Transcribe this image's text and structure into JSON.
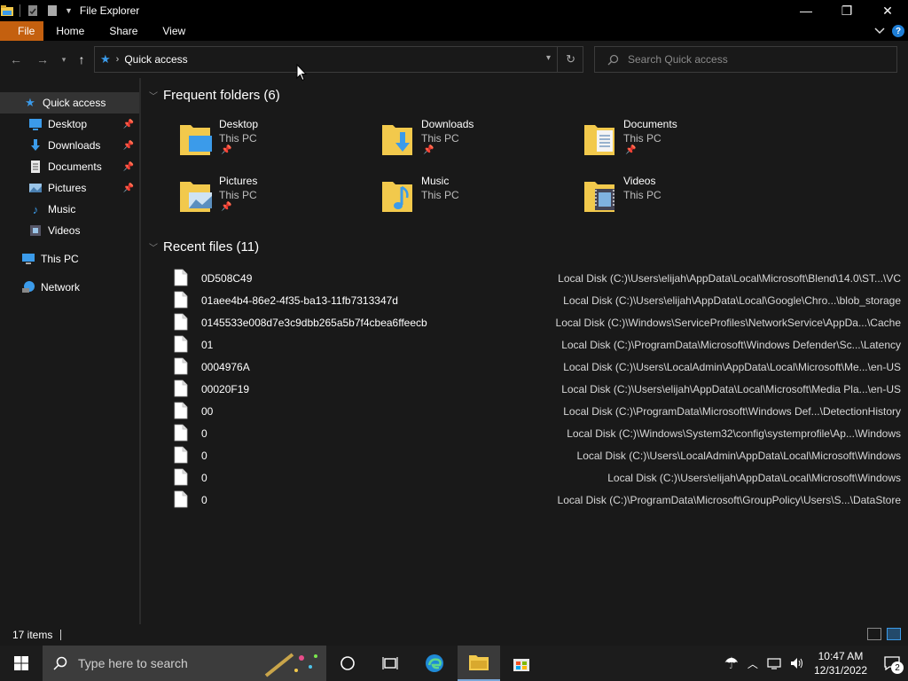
{
  "window": {
    "title": "File Explorer",
    "controls": {
      "minimize": "—",
      "restore": "❐",
      "close": "✕"
    }
  },
  "ribbon": {
    "tabs": [
      "File",
      "Home",
      "Share",
      "View"
    ],
    "help": "?"
  },
  "address": {
    "path": "Quick access",
    "star": "★",
    "chevron": "›",
    "refresh": "↻"
  },
  "search": {
    "placeholder": "Search Quick access"
  },
  "sidebar": {
    "items": [
      {
        "label": "Quick access",
        "icon": "star-icon",
        "color": "#3b9bea"
      },
      {
        "label": "Desktop",
        "icon": "desktop-icon",
        "pinned": true
      },
      {
        "label": "Downloads",
        "icon": "download-icon",
        "pinned": true
      },
      {
        "label": "Documents",
        "icon": "document-icon",
        "pinned": true
      },
      {
        "label": "Pictures",
        "icon": "picture-icon",
        "pinned": true
      },
      {
        "label": "Music",
        "icon": "music-icon"
      },
      {
        "label": "Videos",
        "icon": "video-icon"
      },
      {
        "label": "This PC",
        "icon": "computer-icon"
      },
      {
        "label": "Network",
        "icon": "network-icon"
      }
    ]
  },
  "frequent": {
    "header": "Frequent folders (6)",
    "folders": [
      {
        "name": "Desktop",
        "location": "This PC"
      },
      {
        "name": "Downloads",
        "location": "This PC"
      },
      {
        "name": "Documents",
        "location": "This PC"
      },
      {
        "name": "Pictures",
        "location": "This PC"
      },
      {
        "name": "Music",
        "location": "This PC"
      },
      {
        "name": "Videos",
        "location": "This PC"
      }
    ]
  },
  "recent": {
    "header": "Recent files (11)",
    "files": [
      {
        "name": "0D508C49",
        "path": "Local Disk (C:)\\Users\\elijah\\AppData\\Local\\Microsoft\\Blend\\14.0\\ST...\\VC"
      },
      {
        "name": "01aee4b4-86e2-4f35-ba13-11fb7313347d",
        "path": "Local Disk (C:)\\Users\\elijah\\AppData\\Local\\Google\\Chro...\\blob_storage"
      },
      {
        "name": "0145533e008d7e3c9dbb265a5b7f4cbea6ffeecb",
        "path": "Local Disk (C:)\\Windows\\ServiceProfiles\\NetworkService\\AppDa...\\Cache"
      },
      {
        "name": "01",
        "path": "Local Disk (C:)\\ProgramData\\Microsoft\\Windows Defender\\Sc...\\Latency"
      },
      {
        "name": "0004976A",
        "path": "Local Disk (C:)\\Users\\LocalAdmin\\AppData\\Local\\Microsoft\\Me...\\en-US"
      },
      {
        "name": "00020F19",
        "path": "Local Disk (C:)\\Users\\elijah\\AppData\\Local\\Microsoft\\Media Pla...\\en-US"
      },
      {
        "name": "00",
        "path": "Local Disk (C:)\\ProgramData\\Microsoft\\Windows Def...\\DetectionHistory"
      },
      {
        "name": "0",
        "path": "Local Disk (C:)\\Windows\\System32\\config\\systemprofile\\Ap...\\Windows"
      },
      {
        "name": "0",
        "path": "Local Disk (C:)\\Users\\LocalAdmin\\AppData\\Local\\Microsoft\\Windows"
      },
      {
        "name": "0",
        "path": "Local Disk (C:)\\Users\\elijah\\AppData\\Local\\Microsoft\\Windows"
      },
      {
        "name": "0",
        "path": "Local Disk (C:)\\ProgramData\\Microsoft\\GroupPolicy\\Users\\S...\\DataStore"
      }
    ]
  },
  "status": {
    "count": "17 items"
  },
  "taskbar": {
    "search_placeholder": "Type here to search",
    "time": "10:47 AM",
    "date": "12/31/2022",
    "notifications": "2"
  },
  "colors": {
    "accent": "#3b9bea",
    "file_tab": "#c4600f",
    "folder": "#f2c94c"
  }
}
